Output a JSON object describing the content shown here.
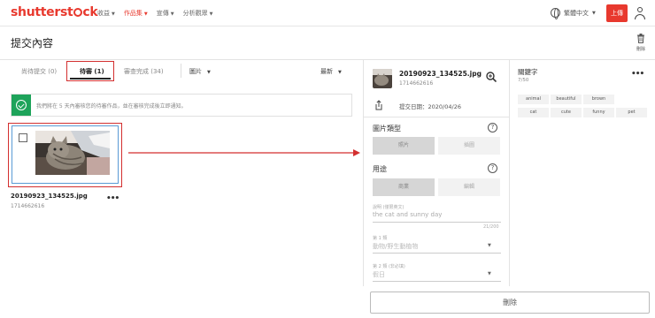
{
  "brand": {
    "logo_text_a": "shutterst",
    "logo_text_b": "ck"
  },
  "nav": {
    "items": [
      "收益",
      "作品集",
      "宣傳",
      "分析觀眾"
    ],
    "active_index": 1
  },
  "header": {
    "language": "繁體中文",
    "upload_label": "上傳"
  },
  "page": {
    "title": "提交內容",
    "delete_icon_label": "刪除"
  },
  "tabs": {
    "pending": "尚待提交 (0)",
    "reviewing": "待審 (1)",
    "reviewed": "審查完成 (34)",
    "media_type": "圖片",
    "sort": "最新"
  },
  "notice": {
    "text": "我們將在 5 天內審核您的待審作品，並在審核完成後立即通知。"
  },
  "file": {
    "name": "20190923_134525.jpg",
    "id": "1714662616"
  },
  "detail": {
    "submitted_label": "提交日期：2020/04/26",
    "image_type": {
      "label": "圖片類型",
      "option_a": "照片",
      "option_b": "插圖"
    },
    "usage": {
      "label": "用途",
      "option_a": "商業",
      "option_b": "編輯"
    },
    "description": {
      "label": "說明 (僅限英文)",
      "value": "the cat and sunny day",
      "counter": "21/200"
    },
    "category1": {
      "label": "第 1 類",
      "value": "動物/野生動植物"
    },
    "category2": {
      "label": "第 2 類 (非必填)",
      "value": "假日"
    }
  },
  "keywords": {
    "title": "關鍵字",
    "count": "7/50",
    "items": [
      "animal",
      "beautiful",
      "brown",
      "cat",
      "cute",
      "funny",
      "pet"
    ]
  },
  "actions": {
    "delete": "刪除"
  },
  "colors": {
    "brand_red": "#e8392e",
    "success_green": "#1ea35a",
    "annotation_red": "#d32f2f",
    "selection_blue": "#5a9bd5"
  }
}
